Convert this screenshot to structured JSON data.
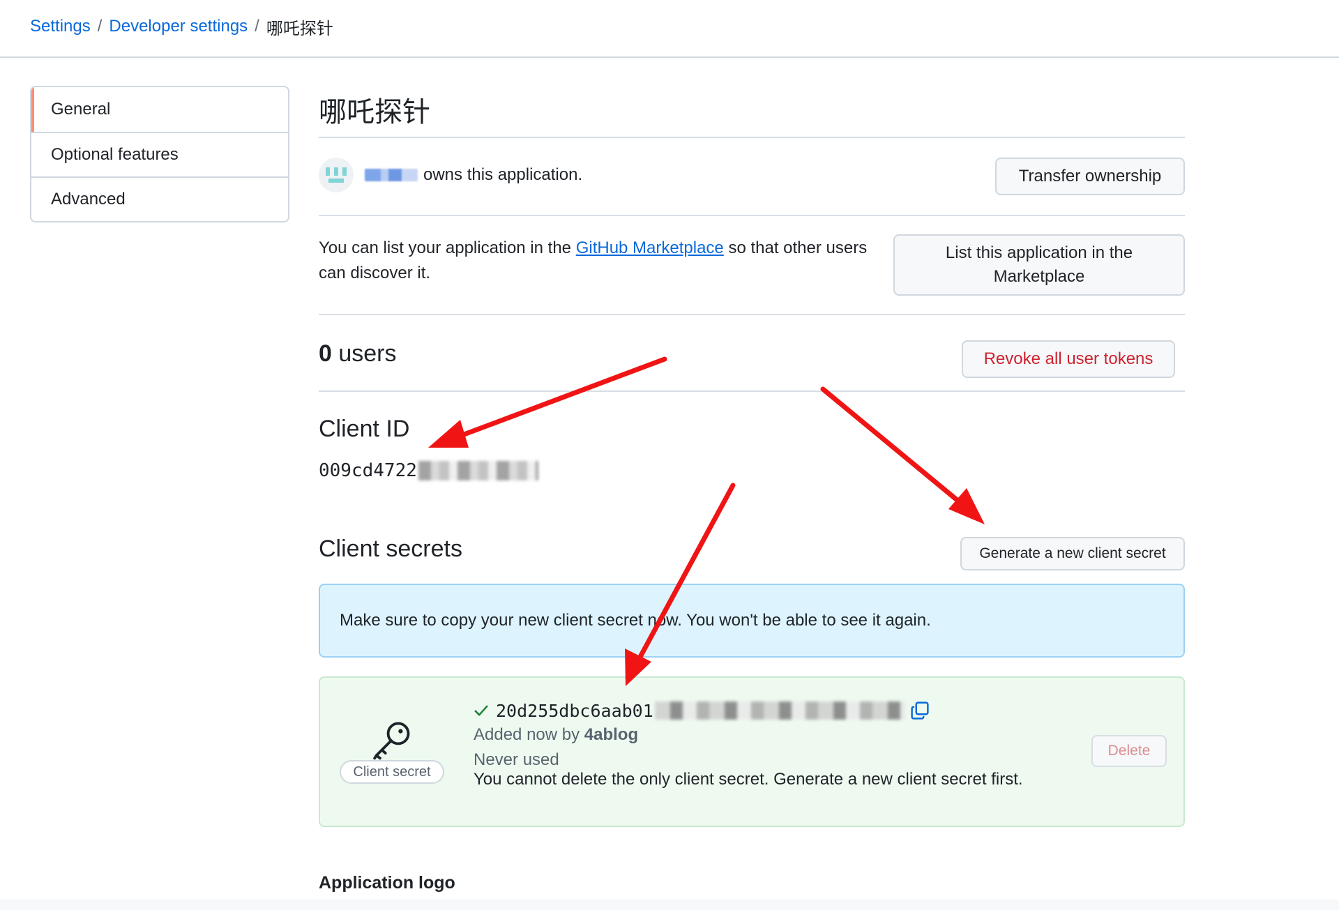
{
  "breadcrumb": {
    "items": [
      "Settings",
      "Developer settings"
    ],
    "current": "哪吒探针",
    "separator": "/"
  },
  "sidebar": {
    "items": [
      {
        "label": "General",
        "active": true
      },
      {
        "label": "Optional features",
        "active": false
      },
      {
        "label": "Advanced",
        "active": false
      }
    ]
  },
  "app": {
    "title": "哪吒探针",
    "owner_text": "owns this application.",
    "transfer_label": "Transfer ownership"
  },
  "marketplace": {
    "text_before": "You can list your application in the ",
    "link_label": "GitHub Marketplace",
    "text_after": " so that other users can discover it.",
    "button_line1": "List this application in the",
    "button_line2": "Marketplace"
  },
  "users": {
    "count": "0",
    "label": " users",
    "revoke_label": "Revoke all user tokens"
  },
  "client_id": {
    "heading": "Client ID",
    "value_visible": "009cd4722"
  },
  "client_secrets": {
    "heading": "Client secrets",
    "generate_label": "Generate a new client secret",
    "flash_message": "Make sure to copy your new client secret now. You won't be able to see it again.",
    "badge_label": "Client secret",
    "secret_visible": "20d255dbc6aab01",
    "added_prefix": "Added now by ",
    "added_by": "4ablog",
    "usage": "Never used",
    "warning": "You cannot delete the only client secret. Generate a new client secret first.",
    "delete_label": "Delete"
  },
  "application_logo": {
    "heading": "Application logo"
  },
  "colors": {
    "link": "#0969da",
    "danger": "#cf222e",
    "flash_bg": "#ddf4ff",
    "success_bg": "#eefaf0",
    "sidebar_accent": "#fd8c73",
    "annotation_arrow": "#f01414"
  }
}
